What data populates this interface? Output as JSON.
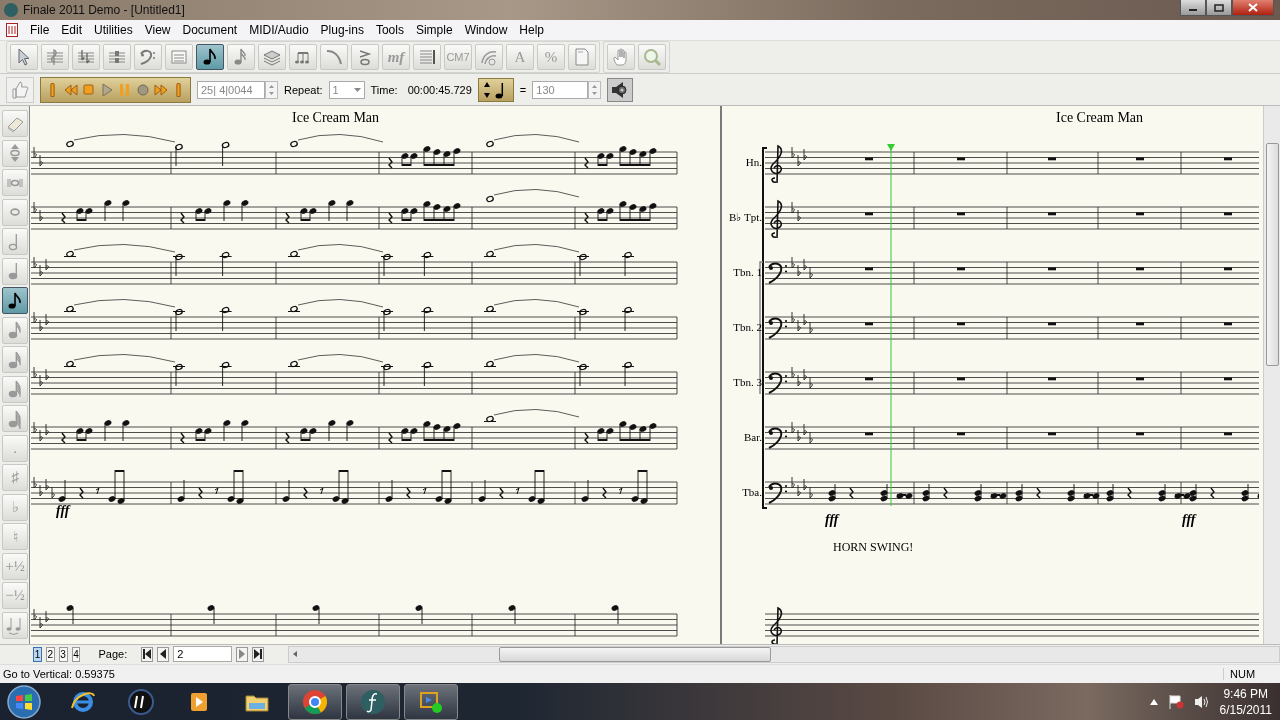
{
  "window": {
    "title": "Finale 2011 Demo - [Untitled1]"
  },
  "menu": [
    "File",
    "Edit",
    "Utilities",
    "View",
    "Document",
    "MIDI/Audio",
    "Plug-ins",
    "Tools",
    "Simple",
    "Window",
    "Help"
  ],
  "main_toolbar": {
    "tools": [
      {
        "kind": "selection",
        "selected": false
      },
      {
        "kind": "staff",
        "selected": false
      },
      {
        "kind": "key",
        "selected": false
      },
      {
        "kind": "time",
        "selected": false
      },
      {
        "kind": "clef",
        "selected": false
      },
      {
        "kind": "measure",
        "selected": false
      },
      {
        "kind": "eighth",
        "selected": true
      },
      {
        "kind": "speedy",
        "selected": false
      },
      {
        "kind": "layers",
        "selected": false
      },
      {
        "kind": "tuplet",
        "selected": false
      },
      {
        "kind": "curve",
        "selected": false
      },
      {
        "kind": "articulation",
        "selected": false
      },
      {
        "kind": "label",
        "label": "mf",
        "selected": false
      },
      {
        "kind": "lines",
        "selected": false
      },
      {
        "kind": "label",
        "label": "CM7",
        "selected": false
      },
      {
        "kind": "lyrics",
        "selected": false
      },
      {
        "kind": "label",
        "label": "A",
        "selected": false
      },
      {
        "kind": "label",
        "label": "%",
        "selected": false
      },
      {
        "kind": "page",
        "selected": false
      }
    ],
    "extra_tools": [
      {
        "kind": "hand",
        "selected": false
      },
      {
        "kind": "zoom",
        "selected": false
      }
    ]
  },
  "playback": {
    "controls": [
      {
        "kind": "start"
      },
      {
        "kind": "rewind"
      },
      {
        "kind": "stop"
      },
      {
        "kind": "play"
      },
      {
        "kind": "pause"
      },
      {
        "kind": "record"
      },
      {
        "kind": "forward"
      },
      {
        "kind": "end"
      }
    ],
    "measure": "25| 4|0044",
    "repeat_label": "Repeat:",
    "repeat": "1",
    "time_label": "Time:",
    "time": "00:00:45.729",
    "equals": "=",
    "tempo": "130"
  },
  "palette": {
    "tools": [
      {
        "kind": "eraser",
        "selected": false
      },
      {
        "kind": "updown",
        "selected": false
      },
      {
        "kind": "breve",
        "selected": false
      },
      {
        "kind": "whole",
        "selected": false
      },
      {
        "kind": "half",
        "selected": false
      },
      {
        "kind": "quarter",
        "selected": false
      },
      {
        "kind": "eighth",
        "selected": true
      },
      {
        "kind": "sixteenth",
        "selected": false
      },
      {
        "kind": "thirtysecond",
        "selected": false
      },
      {
        "kind": "sixtyfourth",
        "selected": false
      },
      {
        "kind": "hundredtwentyeighth",
        "selected": false
      },
      {
        "kind": "label",
        "label": ".",
        "selected": false
      },
      {
        "kind": "label",
        "label": "♯",
        "selected": false
      },
      {
        "kind": "label",
        "label": "♭",
        "selected": false
      },
      {
        "kind": "label",
        "label": "♮",
        "selected": false
      },
      {
        "kind": "label",
        "label": "+½",
        "selected": false
      },
      {
        "kind": "label",
        "label": "−½",
        "selected": false
      },
      {
        "kind": "tie",
        "selected": false
      }
    ]
  },
  "pages": {
    "left": {
      "title": "Ice Cream Man",
      "dynamics": [
        "fff"
      ]
    },
    "right": {
      "title": "Ice Cream Man",
      "staff_labels": [
        "Hn.",
        "B♭ Tpt.",
        "Tbn. 1",
        "Tbn. 2",
        "Tbn. 3",
        "Bar.",
        "Tba."
      ],
      "dynamics": [
        "fff",
        "fff"
      ],
      "expression": "HORN SWING!"
    }
  },
  "page_nav": {
    "tabs": [
      {
        "label": "1",
        "selected": true
      },
      {
        "label": "2",
        "selected": false
      },
      {
        "label": "3",
        "selected": false
      },
      {
        "label": "4",
        "selected": false
      }
    ],
    "page_label": "Page:",
    "page": "2"
  },
  "status_bar": {
    "message": "Go to Vertical: 0.59375",
    "indicator": "NUM"
  },
  "taskbar": {
    "apps": [
      {
        "kind": "ie",
        "active": false
      },
      {
        "kind": "hp",
        "active": false
      },
      {
        "kind": "media",
        "active": false
      },
      {
        "kind": "folder",
        "active": false
      },
      {
        "kind": "chrome",
        "active": true
      },
      {
        "kind": "finale",
        "active": true
      },
      {
        "kind": "remote",
        "active": true
      }
    ],
    "clock": {
      "time": "9:46 PM",
      "date": "6/15/2011"
    }
  }
}
